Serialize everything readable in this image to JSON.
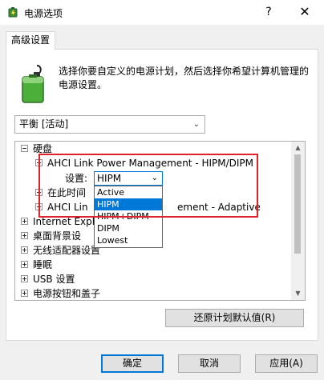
{
  "window": {
    "title": "电源选项",
    "help": "?",
    "close": "✕"
  },
  "tab": {
    "label": "高级设置"
  },
  "description": "选择你要自定义的电源计划，然后选择你希望计算机管理的电源设置。",
  "plan": {
    "selected": "平衡 [活动]"
  },
  "tree": {
    "disk": "硬盘",
    "ahci_hipm": "AHCI Link Power Management - HIPM/DIPM",
    "setting_label": "设置:",
    "setting_value": "HIPM",
    "after_time": "在此时间",
    "ahci_adaptive_prefix": "AHCI Lin",
    "ahci_adaptive_suffix": "ement - Adaptive",
    "internet_explorer": "Internet Explo",
    "desktop_bg": "桌面背景设",
    "wireless": "无线适配器设置",
    "sleep": "睡眠",
    "usb": "USB 设置",
    "power_buttons": "电源按钮和盖子"
  },
  "dropdown": {
    "options": [
      "Active",
      "HIPM",
      "HIPM+DIPM",
      "DIPM",
      "Lowest"
    ],
    "selected_index": 1
  },
  "buttons": {
    "restore": "还原计划默认值(R)",
    "ok": "确定",
    "cancel": "取消",
    "apply": "应用(A)"
  },
  "colors": {
    "accent": "#0078d7",
    "highlight": "#e0202a"
  }
}
